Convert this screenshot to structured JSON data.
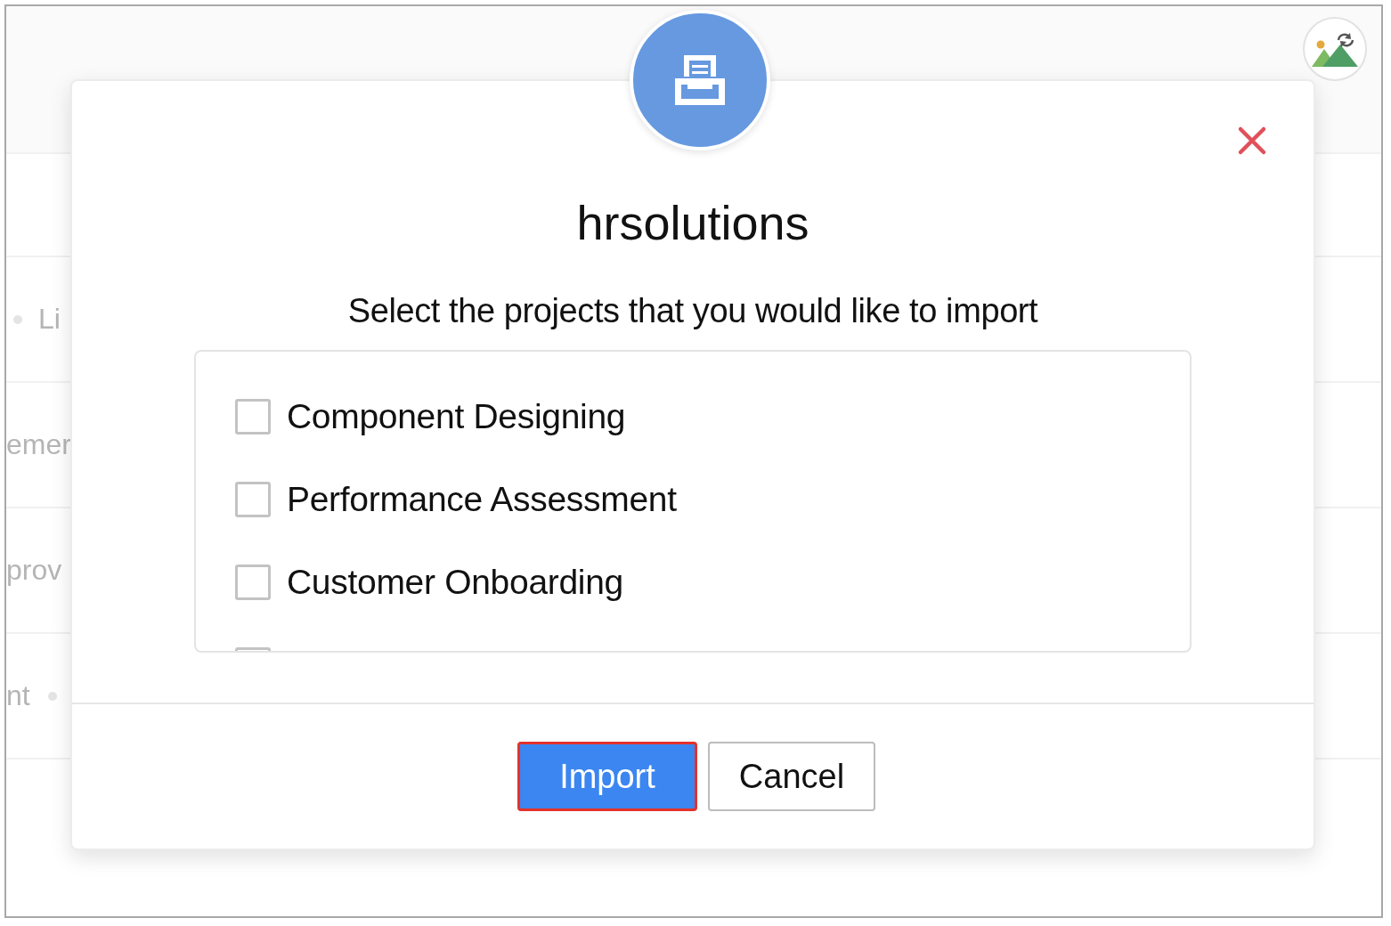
{
  "background_rows": [
    {},
    {},
    {
      "text": "Li",
      "bullet_before": true
    },
    {
      "text": "emer"
    },
    {
      "text": "prov"
    },
    {
      "text": "nt",
      "bullet_after": true
    }
  ],
  "dialog": {
    "title": "hrsolutions",
    "subtitle": "Select the projects that you would like to import",
    "projects": [
      {
        "label": "Component Designing",
        "checked": false
      },
      {
        "label": "Performance Assessment",
        "checked": false
      },
      {
        "label": "Customer Onboarding",
        "checked": false
      },
      {
        "checked": false
      }
    ],
    "buttons": [
      {
        "label": "Import",
        "kind": "primary",
        "focused": true
      },
      {
        "label": "Cancel",
        "kind": "secondary",
        "focused": false
      }
    ]
  }
}
